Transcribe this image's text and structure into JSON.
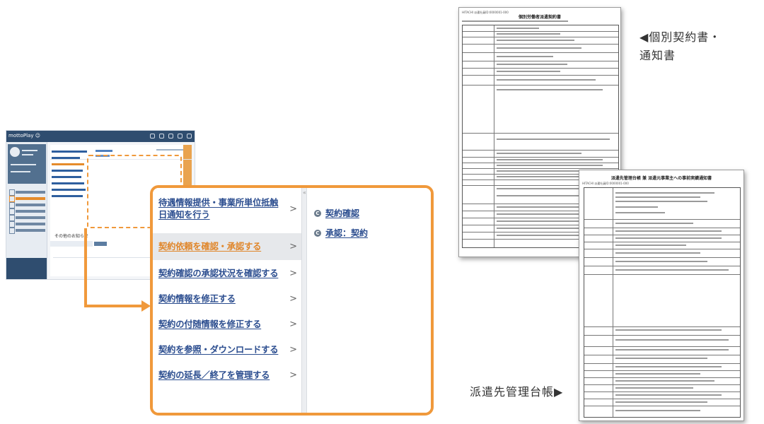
{
  "thumbnail": {
    "logo": "mottoPlay ☺",
    "news_heading": "その他のお知らせ"
  },
  "panel": {
    "menu_items": [
      {
        "label": "待遇情報提供・事業所単位抵触日通知を行う",
        "active": false
      },
      {
        "label": "契約依頼を確認・承認する",
        "active": true
      },
      {
        "label": "契約確認の承認状況を確認する",
        "active": false
      },
      {
        "label": "契約情報を修正する",
        "active": false
      },
      {
        "label": "契約の付随情報を修正する",
        "active": false
      },
      {
        "label": "契約を参照・ダウンロードする",
        "active": false
      },
      {
        "label": "契約の延長／終了を管理する",
        "active": false
      }
    ],
    "chevron": ">",
    "sub_items": [
      {
        "icon": "C",
        "label": "契約確認"
      },
      {
        "icon": "C",
        "label": "承認：契約"
      }
    ]
  },
  "doc1": {
    "title": "個別労働者派遣契約書",
    "header": "HITACHI 派遣社員ID:0000001-000"
  },
  "doc2": {
    "title": "派遣先管理台帳 兼 派遣元事業主への事前実績通知書",
    "header": "HITACHI 派遣社員ID:0000001-000"
  },
  "captions": {
    "contract": "◀個別契約書・\n通知書",
    "ledger": "派遣先管理台帳▶"
  },
  "accent_color": "#f0993b",
  "link_color": "#2b4d8f"
}
